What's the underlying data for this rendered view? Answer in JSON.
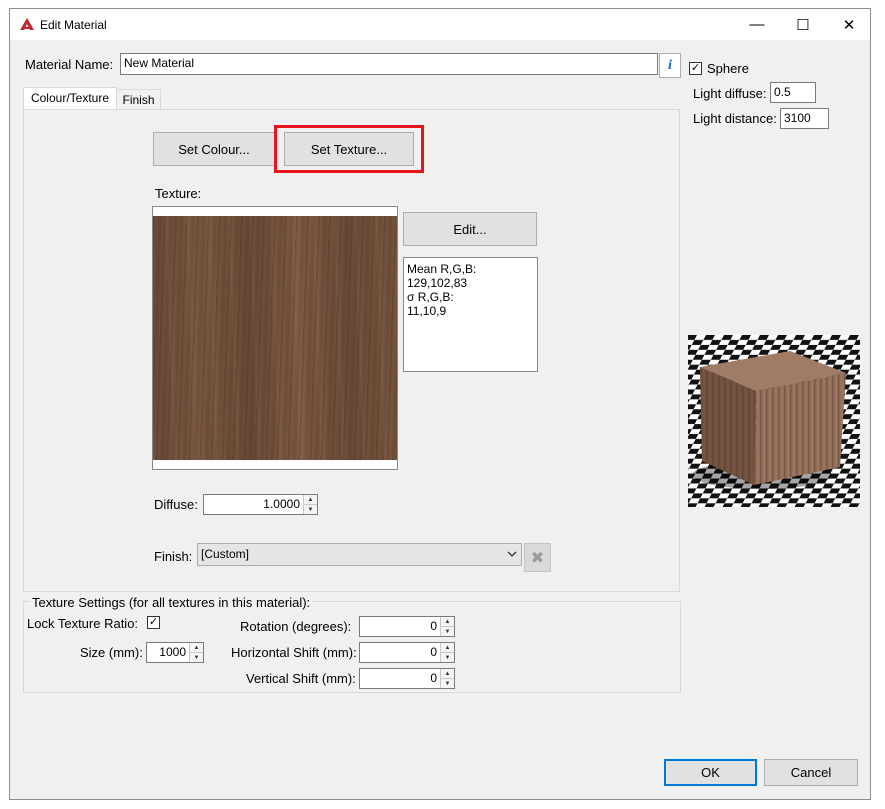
{
  "window": {
    "title": "Edit Material",
    "minimize_glyph": "—",
    "maximize_glyph": "☐",
    "close_glyph": "✕"
  },
  "material_name": {
    "label": "Material Name:",
    "value": "New Material",
    "info_glyph": "i"
  },
  "tabs": [
    {
      "label": "Colour/Texture",
      "active": true
    },
    {
      "label": "Finish",
      "active": false
    }
  ],
  "colour_texture": {
    "set_colour_label": "Set Colour...",
    "set_texture_label": "Set Texture...",
    "highlight_color": "#e8141b",
    "texture_label": "Texture:",
    "edit_label": "Edit...",
    "stats": {
      "mean_label": "Mean R,G,B:",
      "mean_value": "129,102,83",
      "sigma_label": "σ R,G,B:",
      "sigma_value": "11,10,9"
    },
    "diffuse_label": "Diffuse:",
    "diffuse_value": "1.0000",
    "finish_label": "Finish:",
    "finish_value": "[Custom]",
    "clear_glyph": "✖"
  },
  "texture_settings": {
    "title": "Texture Settings (for all textures in this material):",
    "lock_label": "Lock Texture Ratio:",
    "lock_checked": true,
    "size_label": "Size (mm):",
    "size_value": "1000",
    "rotation_label": "Rotation (degrees):",
    "rotation_value": "0",
    "hshift_label": "Horizontal Shift (mm):",
    "hshift_value": "0",
    "vshift_label": "Vertical Shift (mm):",
    "vshift_value": "0"
  },
  "preview": {
    "sphere_label": "Sphere",
    "sphere_checked": true,
    "light_diffuse_label": "Light diffuse:",
    "light_diffuse_value": "0.5",
    "light_distance_label": "Light distance:",
    "light_distance_value": "3100"
  },
  "footer": {
    "ok_label": "OK",
    "cancel_label": "Cancel"
  },
  "colors": {
    "accent": "#0078d7",
    "wood": "#815d47",
    "app_icon": "#c4262e"
  },
  "icons": [
    "app-logo-icon",
    "info-icon",
    "checkbox-check-icon",
    "chevron-down-icon",
    "clear-x-icon"
  ]
}
